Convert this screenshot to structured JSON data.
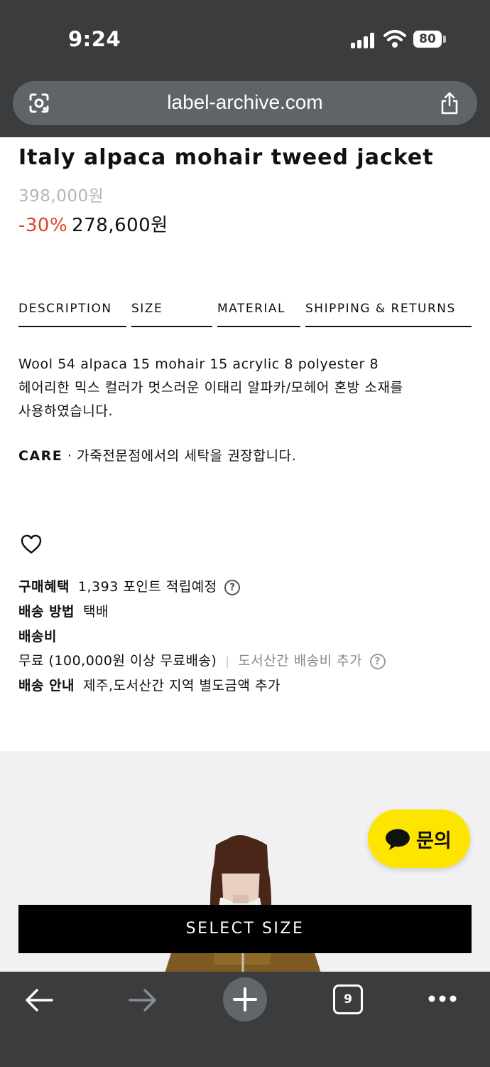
{
  "status_bar": {
    "time": "9:24",
    "battery": "80"
  },
  "browser": {
    "url": "label-archive.com",
    "tab_count": "9"
  },
  "product": {
    "title": "Italy alpaca mohair tweed jacket",
    "original_price": "398,000원",
    "discount": "-30%",
    "sale_price": "278,600원"
  },
  "tabs": [
    {
      "label": "DESCRIPTION"
    },
    {
      "label": "SIZE"
    },
    {
      "label": "MATERIAL"
    },
    {
      "label": "SHIPPING & RETURNS"
    }
  ],
  "description": {
    "line1": "Wool 54 alpaca 15 mohair 15 acrylic 8 polyester 8",
    "line2": "헤어리한 믹스 컬러가 멋스러운 이태리 알파카/모헤어 혼방 소재를",
    "line3": "사용하였습니다.",
    "care_label": "CARE",
    "care_text": " · 가죽전문점에서의 세탁을 권장합니다."
  },
  "info": {
    "benefit_label": "구매혜택",
    "benefit_value": "1,393 포인트 적립예정",
    "method_label": "배송 방법",
    "method_value": "택배",
    "fee_label": "배송비",
    "fee_value": "무료 (100,000원 이상 무료배송)",
    "fee_extra": "도서산간 배송비 추가",
    "guide_label": "배송 안내",
    "guide_value": "제주,도서산간 지역 별도금액 추가"
  },
  "chat_button": {
    "label": "문의"
  },
  "cta": {
    "label": "SELECT SIZE"
  },
  "icons": {
    "heart": "heart-icon",
    "help": "question-circle-icon",
    "chat": "chat-bubble-icon"
  },
  "colors": {
    "discount": "#e4402a",
    "chat_yellow": "#fee500",
    "chrome": "#3a3c3e"
  }
}
